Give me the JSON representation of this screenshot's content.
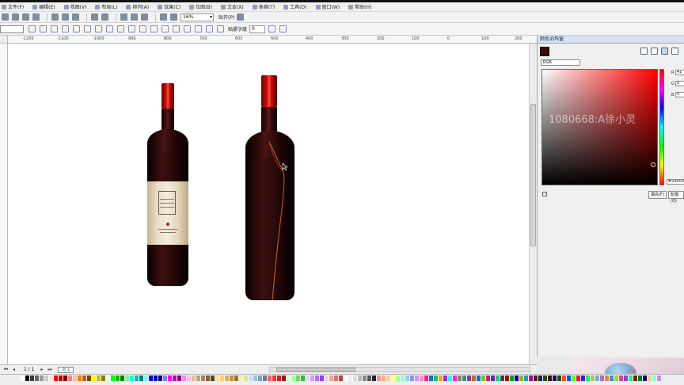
{
  "menu": {
    "items": [
      "文件(F)",
      "编辑(E)",
      "视图(V)",
      "布局(L)",
      "排列(A)",
      "效果(C)",
      "位图(B)",
      "文本(X)",
      "表格(T)",
      "工具(O)",
      "窗口(W)",
      "帮助(H)"
    ]
  },
  "toolbar": {
    "zoom_value": "16%",
    "snap_label": "贴齐(P)"
  },
  "property_bar": {
    "nudge_label": "贴紧字级",
    "nudge_value": "0"
  },
  "ruler": {
    "h_ticks": [
      "-1200",
      "-1100",
      "-1000",
      "900",
      "800",
      "700",
      "600",
      "500",
      "400",
      "300",
      "200",
      "100",
      "0",
      "100",
      "200",
      "300",
      "400"
    ]
  },
  "page_nav": {
    "counter": "1 / 1",
    "page_tab": "页 1"
  },
  "docker": {
    "title": "颜色泊坞窗",
    "model": "RGB",
    "current_color": "#3a0b0b",
    "channels": [
      {
        "label": "R",
        "value": "41"
      },
      {
        "label": "G",
        "value": "0"
      },
      {
        "label": "B",
        "value": "0"
      }
    ],
    "hex_value": "#290000",
    "watermark": "1080668:A徐小灵",
    "fill_button": "填充(F)",
    "outline_button": "轮廓(O)"
  },
  "palette": {
    "colors": [
      "#ffffff",
      "#000000",
      "#3a3a3a",
      "#666666",
      "#999999",
      "#cccccc",
      "#ffe0e0",
      "#ff0000",
      "#c00000",
      "#800000",
      "#ff8080",
      "#ffc0a0",
      "#ff8000",
      "#c06000",
      "#804000",
      "#ffff00",
      "#c0c000",
      "#808000",
      "#e0ffe0",
      "#00ff00",
      "#00c000",
      "#008000",
      "#80ff80",
      "#00ffff",
      "#00c0c0",
      "#008080",
      "#80ffff",
      "#0000ff",
      "#0000c0",
      "#000080",
      "#8080ff",
      "#ff00ff",
      "#c000c0",
      "#800080",
      "#ff80ff",
      "#ffc0e0",
      "#e0c0a0",
      "#c0a080",
      "#a08060",
      "#806040",
      "#604020",
      "#ffe0a0",
      "#ffd080",
      "#e0b060",
      "#c09040",
      "#a07020",
      "#f0f0c0",
      "#e0e0a0",
      "#c0e0ff",
      "#a0c0e0",
      "#80a0c0",
      "#6080a0",
      "#ff6060",
      "#ff3030",
      "#d02020",
      "#a01010",
      "#d0ffd0",
      "#a0ffa0",
      "#60e060",
      "#30c030",
      "#f0d0ff",
      "#d0a0ff",
      "#b070ff",
      "#9040ff",
      "#ffd0d0",
      "#f0a0a0",
      "#e07070",
      "#c04040",
      "#ffffff",
      "#eeeeee",
      "#dddddd",
      "#bbbbbb",
      "#888888",
      "#555555",
      "#222222",
      "#ff9090",
      "#ffb090",
      "#ffd090",
      "#ffff90",
      "#b0ff90",
      "#90ffd0",
      "#90d0ff",
      "#9090ff",
      "#d090ff",
      "#ff90d0",
      "#ff2060",
      "#2060ff",
      "#20c060",
      "#ffa020",
      "#a020ff",
      "#20ffff",
      "#ff20ff",
      "#888844",
      "#448888",
      "#884488",
      "#cc6622",
      "#2266cc",
      "#66cc22",
      "#cc2266",
      "#6622cc",
      "#22cc66",
      "#444444",
      "#aa0000",
      "#00aa00",
      "#0000aa",
      "#aaaa00",
      "#00aaaa",
      "#aa00aa",
      "#552200",
      "#002255",
      "#225500",
      "#550022",
      "#220055",
      "#005522",
      "#ff5500",
      "#0055ff",
      "#55ff00",
      "#ff0055",
      "#5500ff",
      "#00ff55",
      "#bbbb66",
      "#66bbbb",
      "#bb66bb",
      "#dd8844",
      "#4488dd",
      "#88dd44",
      "#dd4488",
      "#8844dd",
      "#44dd88",
      "#772200",
      "#007722",
      "#220077",
      "#ffcc88",
      "#88ffcc",
      "#cc88ff"
    ]
  }
}
